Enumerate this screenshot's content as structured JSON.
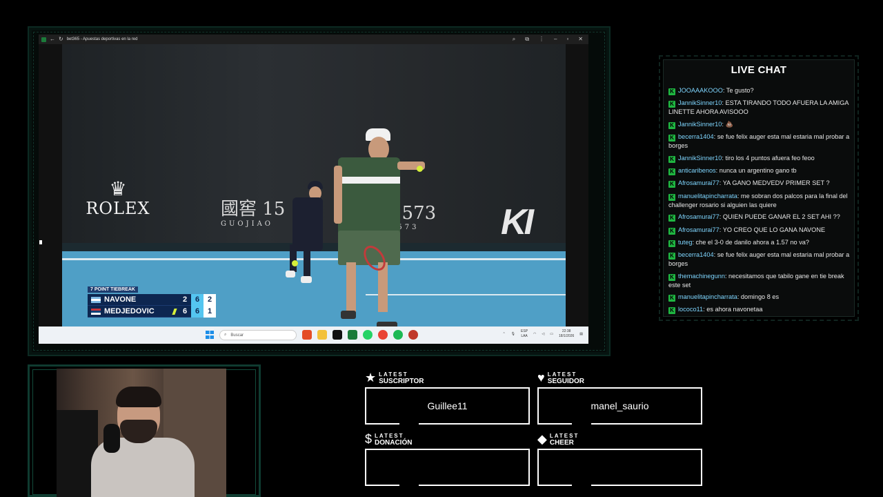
{
  "browser": {
    "tab_title": "bet365 - Apuestas deportivas en la red"
  },
  "video": {
    "sponsor_left": "ROLEX",
    "sponsor_mid_big": "國窖 15",
    "sponsor_mid_small": "GUOJIAO",
    "sponsor_mid2_big": "1573",
    "sponsor_mid2_small": "1573",
    "sponsor_right": "KI"
  },
  "scoreboard": {
    "label": "7 POINT TIEBREAK",
    "players": [
      {
        "name": "NAVONE",
        "flag": "argentina",
        "set1": "2",
        "set2": "6",
        "game": "2",
        "serving": false
      },
      {
        "name": "MEDJEDOVIC",
        "flag": "serbia",
        "set1": "6",
        "set2": "6",
        "game": "1",
        "serving": true
      }
    ]
  },
  "taskbar": {
    "search_placeholder": "Buscar",
    "lang_top": "ESP",
    "lang_bottom": "LAA",
    "time": "22:38",
    "date": "18/1/2026"
  },
  "chat": {
    "title": "LIVE CHAT",
    "badge": "K",
    "messages": [
      {
        "user": "JOOAAAKOOO",
        "text": "Te gusto?"
      },
      {
        "user": "JannikSinner10",
        "text": "ESTA TIRANDO TODO AFUERA LA AMIGA LINETTE AHORA AVISOOO"
      },
      {
        "user": "JannikSinner10",
        "text": "💩"
      },
      {
        "user": "becerra1404",
        "text": "se fue felix auger esta mal estaria mal probar a borges"
      },
      {
        "user": "JannikSinner10",
        "text": "tiro los 4 puntos afuera feo feoo"
      },
      {
        "user": "anticaribenos",
        "text": "nunca un argentino gano tb"
      },
      {
        "user": "Afrosamurai77",
        "text": "YA GANO MEDVEDV PRIMER SET ?"
      },
      {
        "user": "manuelitapincharrata",
        "text": "me sobran dos palcos para la final del challenger rosario si alguien las quiere"
      },
      {
        "user": "Afrosamurai77",
        "text": "QUIEN PUEDE GANAR EL 2 SET AHI ??"
      },
      {
        "user": "Afrosamurai77",
        "text": "YO CREO QUE LO GANA NAVONE"
      },
      {
        "user": "tuteg",
        "text": "che el 3-0 de danilo ahora a 1.57 no va?"
      },
      {
        "user": "becerra1404",
        "text": "se fue felix auger esta mal estaria mal probar a borges"
      },
      {
        "user": "themachinegunn",
        "text": "necesitamos que tabilo gane en tie break este set"
      },
      {
        "user": "manuelitapincharrata",
        "text": "domingo 8 es"
      },
      {
        "user": "lococo11",
        "text": "es ahora navonetaa"
      }
    ]
  },
  "alerts": {
    "suscriptor": {
      "small": "LATEST",
      "big": "SUSCRIPTOR",
      "icon": "star-icon",
      "value": "Guillee11"
    },
    "seguidor": {
      "small": "LATEST",
      "big": "SEGUIDOR",
      "icon": "heart-icon",
      "value": "manel_saurio"
    },
    "donacion": {
      "small": "LATEST",
      "big": "DONACIÓN",
      "icon": "dollar-icon",
      "value": ""
    },
    "cheer": {
      "small": "LATEST",
      "big": "CHEER",
      "icon": "diamond-icon",
      "value": ""
    }
  },
  "colors": {
    "accent": "#1fb541",
    "username": "#7fd6ff",
    "frame": "#0f3b30"
  }
}
